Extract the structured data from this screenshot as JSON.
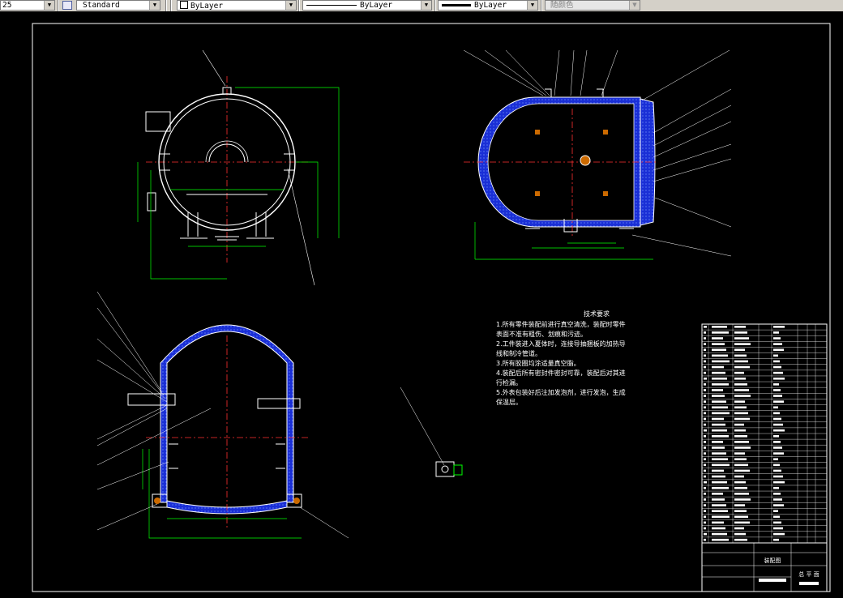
{
  "toolbar": {
    "scale_value": "25",
    "text_style": "Standard",
    "layer_color": "ByLayer",
    "linetype": "ByLayer",
    "lineweight": "ByLayer",
    "plot_style": "随颜色"
  },
  "drawing": {
    "tech_title": "技术要求",
    "tech_lines": [
      "1.所有零件装配前进行真空清洗，装配时零件",
      "表面不准有粗伤、划痕和污迹。",
      "2.工件装进入夏体时，连接导抽捆板的加热导",
      "线和制冷管道。",
      "3.所有胶圈均涂适量真空脂。",
      "4.装配后所有密封件密封可靠，装配后对其进",
      "行检漏。",
      "5.外表包装好后注加发泡剂，进行发泡，生成",
      "保温层。"
    ],
    "title_block_part": "装配图",
    "title_block_name": "总  平  面"
  },
  "colors": {
    "background": "#000000",
    "frame": "#ffffff",
    "vessel_fill": "#1a2fd6",
    "dimension": "#00ff00",
    "centerline": "#ff0000",
    "outline": "#ffffff",
    "hatch": "#cc6a00"
  }
}
